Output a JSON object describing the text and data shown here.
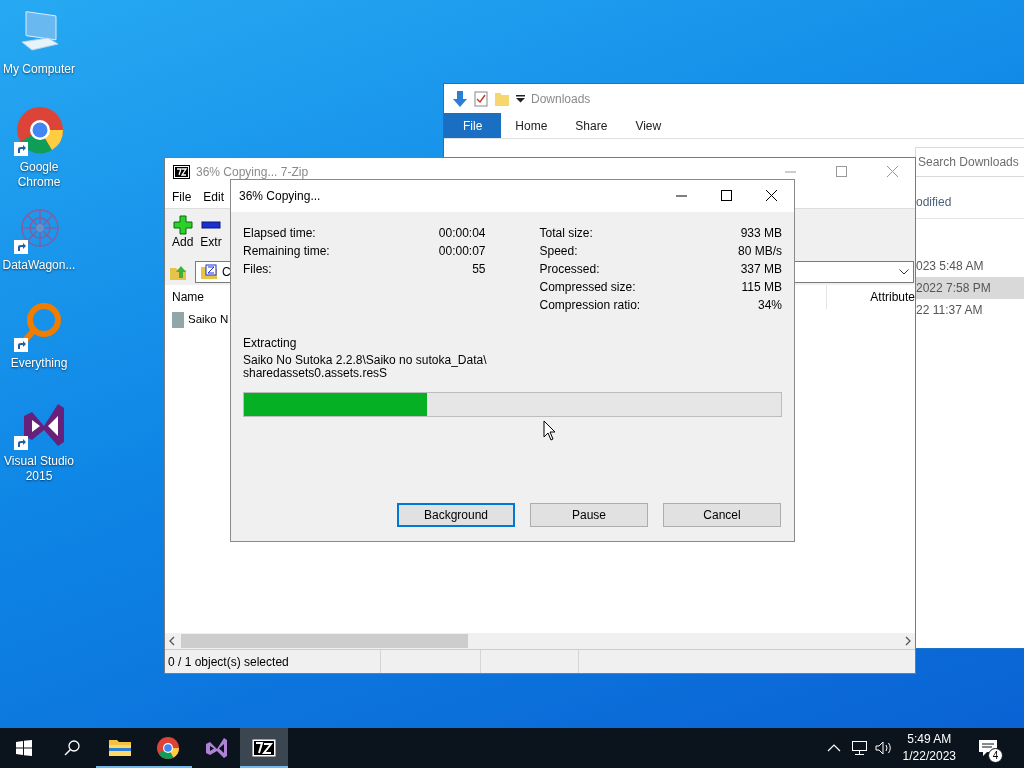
{
  "desktop_icons": [
    {
      "label": "My Computer",
      "kind": "computer",
      "shortcut": false
    },
    {
      "label": "Google Chrome",
      "kind": "chrome",
      "shortcut": true
    },
    {
      "label": "DataWagon...",
      "kind": "datawagon",
      "shortcut": true
    },
    {
      "label": "Everything",
      "kind": "everything",
      "shortcut": true
    },
    {
      "label": "Visual Studio 2015",
      "kind": "vs",
      "shortcut": true
    }
  ],
  "explorer": {
    "title": "Downloads",
    "tabs": [
      {
        "label": "File",
        "selected": true
      },
      {
        "label": "Home",
        "selected": false
      },
      {
        "label": "Share",
        "selected": false
      },
      {
        "label": "View",
        "selected": false
      }
    ],
    "search": {
      "placeholder": "Search Downloads"
    },
    "column_header": "odified",
    "rows": [
      {
        "modified": "023 5:48 AM",
        "selected": false
      },
      {
        "modified": "2022 7:58 PM",
        "selected": true
      },
      {
        "modified": "22 11:37 AM",
        "selected": false
      }
    ]
  },
  "sevenzip": {
    "title": "36% Copying... 7-Zip",
    "menu": [
      "File",
      "Edit"
    ],
    "toolbar": [
      {
        "label": "Add",
        "kind": "add"
      },
      {
        "label": "Extr",
        "kind": "extract"
      }
    ],
    "path": "C",
    "columns": [
      "Name",
      "Attribute"
    ],
    "rows": [
      {
        "name": "Saiko N"
      }
    ],
    "status": "0 / 1 object(s) selected"
  },
  "dialog": {
    "title": "36% Copying...",
    "stats_left": [
      {
        "label": "Elapsed time:",
        "value": "00:00:04"
      },
      {
        "label": "Remaining time:",
        "value": "00:00:07"
      },
      {
        "label": "Files:",
        "value": "55"
      }
    ],
    "stats_right": [
      {
        "label": "Total size:",
        "value": "933 MB"
      },
      {
        "label": "Speed:",
        "value": "80 MB/s"
      },
      {
        "label": "Processed:",
        "value": "337 MB"
      },
      {
        "label": "Compressed size:",
        "value": "115 MB"
      },
      {
        "label": "Compression ratio:",
        "value": "34%"
      }
    ],
    "operation": "Extracting",
    "path_lines": [
      "Saiko No Sutoka 2.2.8\\Saiko no sutoka_Data\\",
      "sharedassets0.assets.resS"
    ],
    "progress": {
      "level": 0.34
    },
    "buttons": [
      {
        "label": "Background",
        "focused": true
      },
      {
        "label": "Pause",
        "focused": false
      },
      {
        "label": "Cancel",
        "focused": false
      }
    ]
  },
  "taskbar": {
    "apps": [
      {
        "kind": "explorer",
        "running": true,
        "active": false
      },
      {
        "kind": "chrome",
        "running": true,
        "active": false
      },
      {
        "kind": "vs",
        "running": false,
        "active": false
      },
      {
        "kind": "sevenzip",
        "running": true,
        "active": true
      }
    ],
    "clock": {
      "time": "5:49 AM",
      "date": "1/22/2023"
    },
    "notifications": "4"
  }
}
